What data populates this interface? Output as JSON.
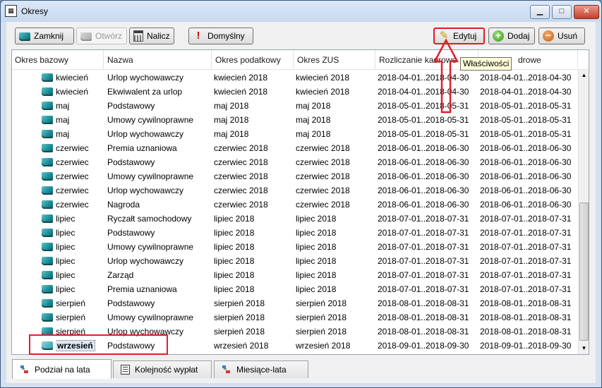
{
  "window": {
    "title": "Okresy",
    "app_icon": "calendar-icon"
  },
  "toolbar": {
    "close_label": "Zamknij",
    "open_label": "Otwórz",
    "calc_label": "Nalicz",
    "default_label": "Domyślny",
    "edit_label": "Edytuj",
    "add_label": "Dodaj",
    "delete_label": "Usuń"
  },
  "tooltip": "Właściwości",
  "columns": {
    "base": "Okres bazowy",
    "name": "Nazwa",
    "tax": "Okres podatkowy",
    "zus": "Okres ZUS",
    "rozl": "Rozliczanie kadrowe",
    "last": "Okres kadrowe",
    "rozl_visible": "Rozliczanie kadrowe",
    "last_visible_suffix": "drowe"
  },
  "rows": [
    {
      "base": "kwiecień",
      "name": "Urlop wychowawczy",
      "tax": "kwiecień 2018",
      "zus": "kwiecień 2018",
      "rozl": "2018-04-01..2018-04-30",
      "last": "2018-04-01..2018-04-30"
    },
    {
      "base": "kwiecień",
      "name": "Ekwiwalent za urlop",
      "tax": "kwiecień 2018",
      "zus": "kwiecień 2018",
      "rozl": "2018-04-01..2018-04-30",
      "last": "2018-04-01..2018-04-30"
    },
    {
      "base": "maj",
      "name": "Podstawowy",
      "tax": "maj 2018",
      "zus": "maj 2018",
      "rozl": "2018-05-01..2018-05-31",
      "last": "2018-05-01..2018-05-31"
    },
    {
      "base": "maj",
      "name": "Umowy cywilnoprawne",
      "tax": "maj 2018",
      "zus": "maj 2018",
      "rozl": "2018-05-01..2018-05-31",
      "last": "2018-05-01..2018-05-31"
    },
    {
      "base": "maj",
      "name": "Urlop wychowawczy",
      "tax": "maj 2018",
      "zus": "maj 2018",
      "rozl": "2018-05-01..2018-05-31",
      "last": "2018-05-01..2018-05-31"
    },
    {
      "base": "czerwiec",
      "name": "Premia uznaniowa",
      "tax": "czerwiec 2018",
      "zus": "czerwiec 2018",
      "rozl": "2018-06-01..2018-06-30",
      "last": "2018-06-01..2018-06-30"
    },
    {
      "base": "czerwiec",
      "name": "Podstawowy",
      "tax": "czerwiec 2018",
      "zus": "czerwiec 2018",
      "rozl": "2018-06-01..2018-06-30",
      "last": "2018-06-01..2018-06-30"
    },
    {
      "base": "czerwiec",
      "name": "Umowy cywilnoprawne",
      "tax": "czerwiec 2018",
      "zus": "czerwiec 2018",
      "rozl": "2018-06-01..2018-06-30",
      "last": "2018-06-01..2018-06-30"
    },
    {
      "base": "czerwiec",
      "name": "Urlop wychowawczy",
      "tax": "czerwiec 2018",
      "zus": "czerwiec 2018",
      "rozl": "2018-06-01..2018-06-30",
      "last": "2018-06-01..2018-06-30"
    },
    {
      "base": "czerwiec",
      "name": "Nagroda",
      "tax": "czerwiec 2018",
      "zus": "czerwiec 2018",
      "rozl": "2018-06-01..2018-06-30",
      "last": "2018-06-01..2018-06-30"
    },
    {
      "base": "lipiec",
      "name": "Ryczałt samochodowy",
      "tax": "lipiec 2018",
      "zus": "lipiec 2018",
      "rozl": "2018-07-01..2018-07-31",
      "last": "2018-07-01..2018-07-31"
    },
    {
      "base": "lipiec",
      "name": "Podstawowy",
      "tax": "lipiec 2018",
      "zus": "lipiec 2018",
      "rozl": "2018-07-01..2018-07-31",
      "last": "2018-07-01..2018-07-31"
    },
    {
      "base": "lipiec",
      "name": "Umowy cywilnoprawne",
      "tax": "lipiec 2018",
      "zus": "lipiec 2018",
      "rozl": "2018-07-01..2018-07-31",
      "last": "2018-07-01..2018-07-31"
    },
    {
      "base": "lipiec",
      "name": "Urlop wychowawczy",
      "tax": "lipiec 2018",
      "zus": "lipiec 2018",
      "rozl": "2018-07-01..2018-07-31",
      "last": "2018-07-01..2018-07-31"
    },
    {
      "base": "lipiec",
      "name": "Zarząd",
      "tax": "lipiec 2018",
      "zus": "lipiec 2018",
      "rozl": "2018-07-01..2018-07-31",
      "last": "2018-07-01..2018-07-31"
    },
    {
      "base": "lipiec",
      "name": "Premia uznaniowa",
      "tax": "lipiec 2018",
      "zus": "lipiec 2018",
      "rozl": "2018-07-01..2018-07-31",
      "last": "2018-07-01..2018-07-31"
    },
    {
      "base": "sierpień",
      "name": "Podstawowy",
      "tax": "sierpień 2018",
      "zus": "sierpień 2018",
      "rozl": "2018-08-01..2018-08-31",
      "last": "2018-08-01..2018-08-31"
    },
    {
      "base": "sierpień",
      "name": "Umowy cywilnoprawne",
      "tax": "sierpień 2018",
      "zus": "sierpień 2018",
      "rozl": "2018-08-01..2018-08-31",
      "last": "2018-08-01..2018-08-31"
    },
    {
      "base": "sierpień",
      "name": "Urlop wychowawczy",
      "tax": "sierpień 2018",
      "zus": "sierpień 2018",
      "rozl": "2018-08-01..2018-08-31",
      "last": "2018-08-01..2018-08-31"
    },
    {
      "base": "wrzesień",
      "name": "Podstawowy",
      "tax": "wrzesień 2018",
      "zus": "wrzesień 2018",
      "rozl": "2018-09-01..2018-09-30",
      "last": "2018-09-01..2018-09-30",
      "selected": true
    }
  ],
  "tabs": [
    {
      "label": "Podział na lata",
      "icon": "tree-icon",
      "active": true
    },
    {
      "label": "Kolejność wypłat",
      "icon": "list-icon",
      "active": false
    },
    {
      "label": "Miesiące-lata",
      "icon": "tree-icon",
      "active": false
    }
  ]
}
